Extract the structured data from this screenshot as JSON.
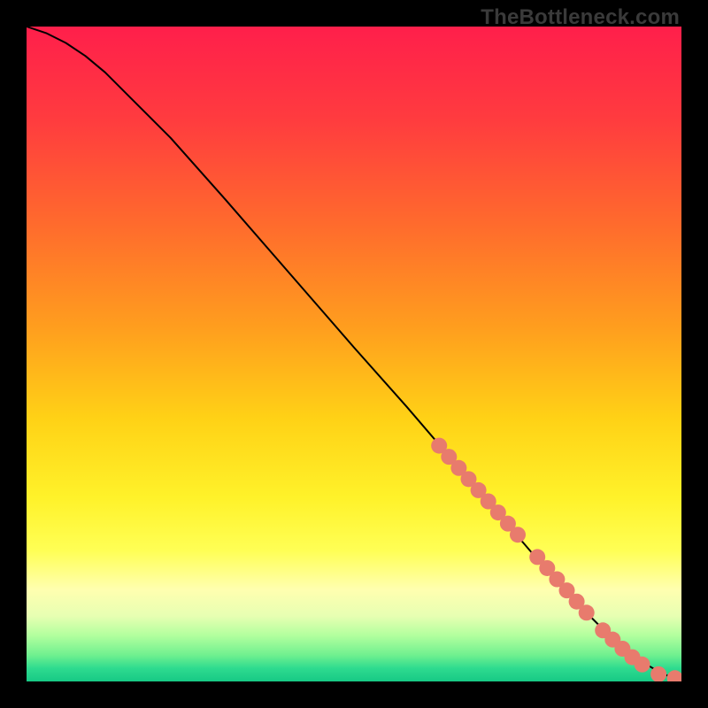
{
  "watermark": "TheBottleneck.com",
  "chart_data": {
    "type": "line",
    "title": "",
    "xlabel": "",
    "ylabel": "",
    "xlim": [
      0,
      100
    ],
    "ylim": [
      0,
      100
    ],
    "grid": false,
    "legend": false,
    "background_gradient": {
      "stops": [
        {
          "offset": 0.0,
          "color": "#ff1f4b"
        },
        {
          "offset": 0.14,
          "color": "#ff3b3f"
        },
        {
          "offset": 0.3,
          "color": "#ff6a2d"
        },
        {
          "offset": 0.46,
          "color": "#ff9e1e"
        },
        {
          "offset": 0.6,
          "color": "#ffd216"
        },
        {
          "offset": 0.72,
          "color": "#fff22a"
        },
        {
          "offset": 0.8,
          "color": "#ffff55"
        },
        {
          "offset": 0.86,
          "color": "#ffffb0"
        },
        {
          "offset": 0.9,
          "color": "#e7ffb2"
        },
        {
          "offset": 0.93,
          "color": "#b2ff9e"
        },
        {
          "offset": 0.96,
          "color": "#6ff08f"
        },
        {
          "offset": 0.98,
          "color": "#2edb8f"
        },
        {
          "offset": 1.0,
          "color": "#17c985"
        }
      ]
    },
    "series": [
      {
        "name": "bottleneck-curve",
        "type": "line",
        "stroke": "#000000",
        "stroke_width": 2,
        "x": [
          0,
          3,
          6,
          9,
          12,
          16,
          22,
          30,
          40,
          50,
          58,
          64,
          70,
          76,
          82,
          86,
          90,
          94,
          97,
          99,
          100
        ],
        "y": [
          100,
          99,
          97.5,
          95.5,
          93,
          89,
          83,
          74,
          62.5,
          51,
          42,
          35,
          28,
          21,
          14,
          10,
          6,
          3,
          1.2,
          0.5,
          0.4
        ]
      },
      {
        "name": "highlight-dots",
        "type": "scatter",
        "color": "#e87b6d",
        "radius": 9,
        "x": [
          63,
          64.5,
          66,
          67.5,
          69,
          70.5,
          72,
          73.5,
          75,
          78,
          79.5,
          81,
          82.5,
          84,
          85.5,
          88,
          89.5,
          91,
          92.5,
          94,
          96.5,
          99
        ],
        "y": [
          36,
          34.3,
          32.6,
          30.9,
          29.2,
          27.5,
          25.8,
          24.1,
          22.4,
          19,
          17.3,
          15.6,
          13.9,
          12.2,
          10.5,
          7.8,
          6.4,
          5,
          3.7,
          2.6,
          1.1,
          0.5
        ]
      }
    ]
  }
}
